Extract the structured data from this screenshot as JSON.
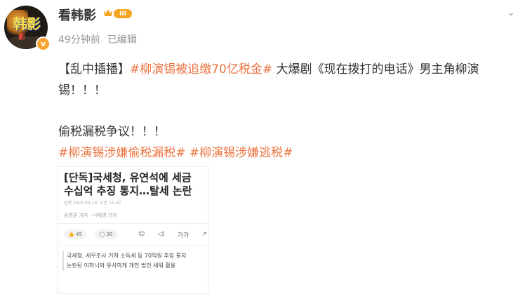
{
  "post": {
    "avatar_text": "韩影",
    "avatar_sub": "影",
    "verify_badge": "v",
    "username": "看韩影",
    "level": "III",
    "time": "49分钟前",
    "edited": "已编辑",
    "line1_prefix": "【乱中插播】",
    "line1_topic": "#柳演锡被追缴70亿税金#",
    "line1_rest": " 大爆剧《现在拨打的电话》男主角柳演",
    "line2": "锡！！！",
    "line3": "偷税漏税争议！！！",
    "line4_topic1": "#柳演锡涉嫌偷税漏税#",
    "line4_topic2": "#柳演锡涉嫌逃税#"
  },
  "card": {
    "title": "[단독]국세청, 유연석에 세금 수십억 추징 통지…탈세 논란",
    "date": "입력 2025.03.14. 오전 11:32",
    "reporters": "송영훈 기자 · 나채영 기자",
    "likes": "45",
    "comments": "30",
    "tool_font": "가가",
    "summary_1": "국세청, 세무조사 거쳐 소득세 등 70억원 추징 통지",
    "summary_2": "논란된 이하늬와 유사하게 개인 법인 세워 활용"
  },
  "icons": {
    "more": "chevron-down-icon",
    "crown": "crown-icon"
  },
  "colors": {
    "topic": "#eb7340",
    "level": "#f4a623"
  }
}
